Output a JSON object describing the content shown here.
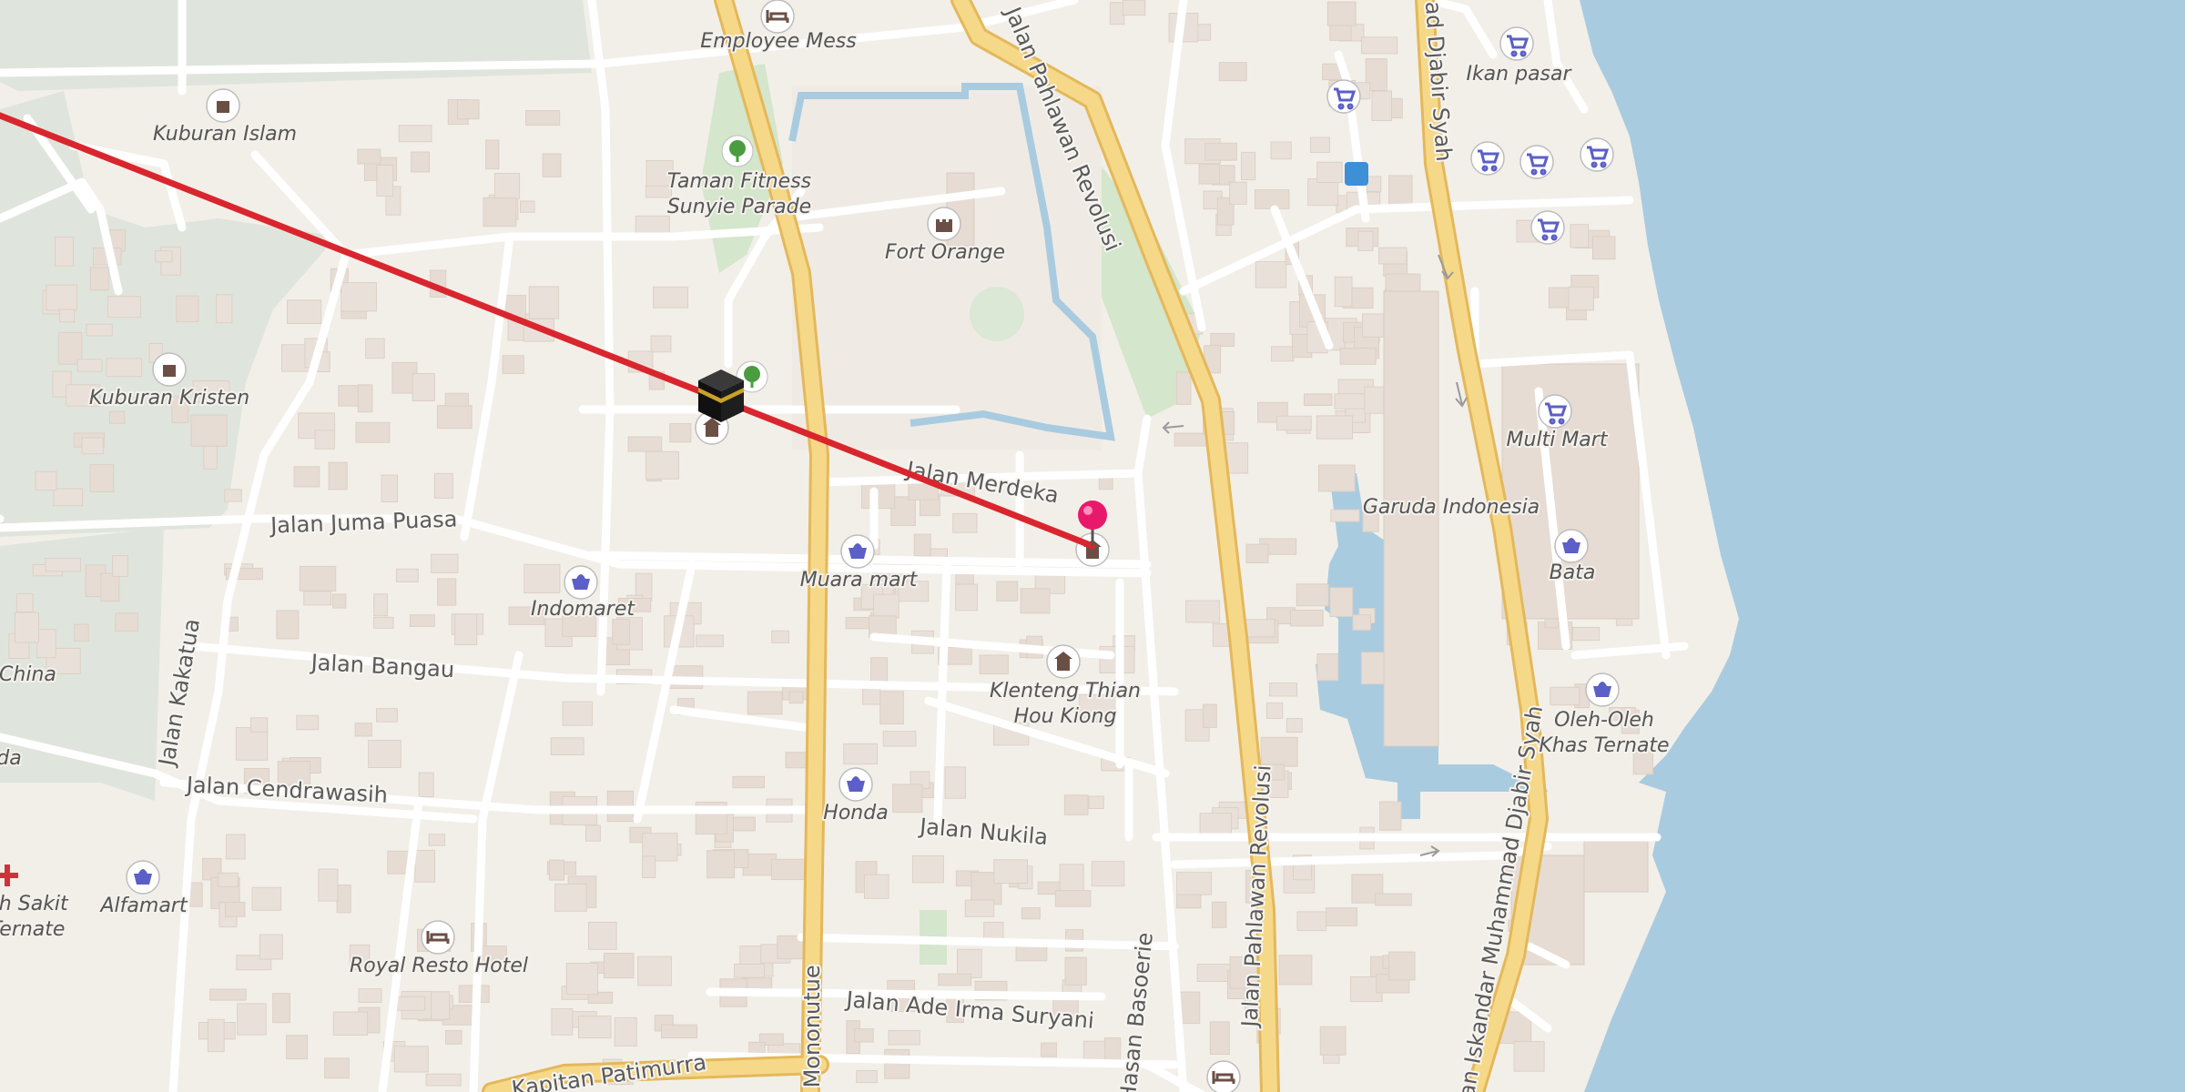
{
  "colors": {
    "land": "#f2efe9",
    "water": "#a9cbe0",
    "park": "#d9e6d2",
    "cemetery": "#dfe5dc",
    "major_road": "#f6d889",
    "major_road_casing": "#e4b85a",
    "minor_road": "#ffffff",
    "building": "#e6dcd3",
    "route_line": "#d9262e",
    "pin": "#e8196b",
    "shop_icon": "#5b5fc7",
    "amenity_icon": "#6b4f45"
  },
  "roads": [
    {
      "name": "Jalan Juma Puasa"
    },
    {
      "name": "Jalan Bangau"
    },
    {
      "name": "Jalan Cendrawasih"
    },
    {
      "name": "Jalan Kakatua"
    },
    {
      "name": "Jalan Merdeka"
    },
    {
      "name": "Jalan Nukila"
    },
    {
      "name": "Jalan Ade Irma Suryani"
    },
    {
      "name": "Kapitan Patimurra"
    },
    {
      "name": "Jalan Pahlawan Revolusi"
    },
    {
      "name": "Jalan Pahlawan Revolusi"
    },
    {
      "name": "Sultan Iskandar Muhammad Djabir Syah"
    },
    {
      "name": "Sultan Iskandar Muhammad Djabir Syah"
    },
    {
      "name": "Sultan Iskandar Muhammad Djabir Syah"
    },
    {
      "name": "Jalan Hasan Basoerie"
    },
    {
      "name": "Jalan Said Mononutue"
    }
  ],
  "roads_display": [
    "Jalan Juma Puasa",
    "Jalan Bangau",
    "Jalan Cendrawasih",
    "Jalan Kakatua",
    "Jalan Merdeka",
    "Jalan Nukila",
    "Jalan Ade Irma Suryani",
    "Kapitan Patimurra",
    "Jalan Pahlawan Revolusi",
    "Jalan Pahlawan Revolusi",
    "ad Djabir Syah",
    "ltan Iskandar Muhammad Djabir Syah",
    "n Hasan Basoerie",
    "aid Mononutue"
  ],
  "places": [
    {
      "name": "Employee Mess",
      "icon": "hotel-icon"
    },
    {
      "name": "Kuburan Islam",
      "icon": "cemetery-icon"
    },
    {
      "name": "Taman Fitness",
      "line2": "Sunyie Parade",
      "icon": "park-icon"
    },
    {
      "name": "Fort Orange",
      "icon": "castle-icon"
    },
    {
      "name": "Kuburan Kristen",
      "icon": "cemetery-icon"
    },
    {
      "name": "Muara mart",
      "icon": "shop-icon"
    },
    {
      "name": "Indomaret",
      "icon": "shop-icon"
    },
    {
      "name": "Klenteng Thian",
      "line2": "Hou Kiong",
      "icon": "temple-icon"
    },
    {
      "name": "Honda",
      "icon": "shop-icon"
    },
    {
      "name": "Alfamart",
      "icon": "shop-icon"
    },
    {
      "name": "Royal Resto Hotel",
      "icon": "hotel-icon"
    },
    {
      "name": "Ikan pasar",
      "icon": "cart-icon"
    },
    {
      "name": "Multi Mart",
      "icon": "cart-icon"
    },
    {
      "name": "Garuda Indonesia",
      "icon": "none"
    },
    {
      "name": "Bata",
      "icon": "shop-icon"
    },
    {
      "name": "Oleh-Oleh",
      "line2": "Khas Ternate",
      "icon": "shop-icon"
    },
    {
      "name": "n China",
      "icon": "none"
    },
    {
      "name": "da",
      "icon": "none"
    },
    {
      "name": "ah Sakit",
      "line2": "Ternate",
      "icon": "hospital-icon"
    }
  ],
  "overlay": {
    "route": "qibla-direction-line",
    "origin_marker": "kaaba-icon",
    "destination_marker": "location-pin-icon"
  }
}
